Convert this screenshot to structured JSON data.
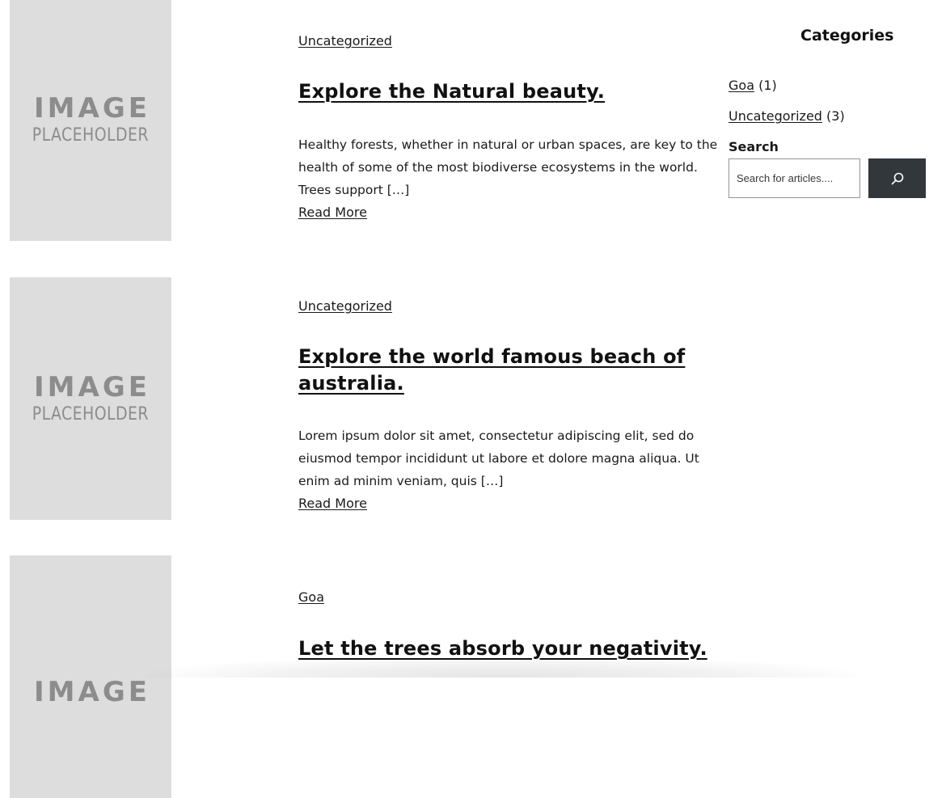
{
  "posts": [
    {
      "thumbnail": {
        "line1": "IMAGE",
        "line2": "PLACEHOLDER"
      },
      "category": "Uncategorized",
      "title": "Explore the Natural beauty.",
      "excerpt": "Healthy forests, whether in natural or urban spaces, are key to the health of some of the most biodiverse ecosystems in the world. Trees support […]",
      "read_more": "Read More"
    },
    {
      "thumbnail": {
        "line1": "IMAGE",
        "line2": "PLACEHOLDER"
      },
      "category": "Uncategorized",
      "title": "Explore the world famous beach of australia.",
      "excerpt": "Lorem ipsum dolor sit amet, consectetur adipiscing elit, sed do eiusmod tempor incididunt ut labore et dolore magna aliqua. Ut enim ad minim veniam, quis […]",
      "read_more": "Read More"
    },
    {
      "thumbnail": {
        "line1": "IMAGE"
      },
      "category": "Goa",
      "title": "Let the trees absorb your negativity."
    }
  ],
  "sidebar": {
    "categories_heading": "Categories",
    "categories": [
      {
        "name": "Goa",
        "count": "(1)"
      },
      {
        "name": "Uncategorized",
        "count": "(3)"
      }
    ],
    "search": {
      "label": "Search",
      "placeholder": "Search for articles....",
      "button_icon": "search-icon",
      "button_color": "#32373c"
    }
  },
  "colors": {
    "placeholder_bg": "#dddddd",
    "placeholder_text": "#8c8c8c",
    "text": "#1a1a1a"
  }
}
